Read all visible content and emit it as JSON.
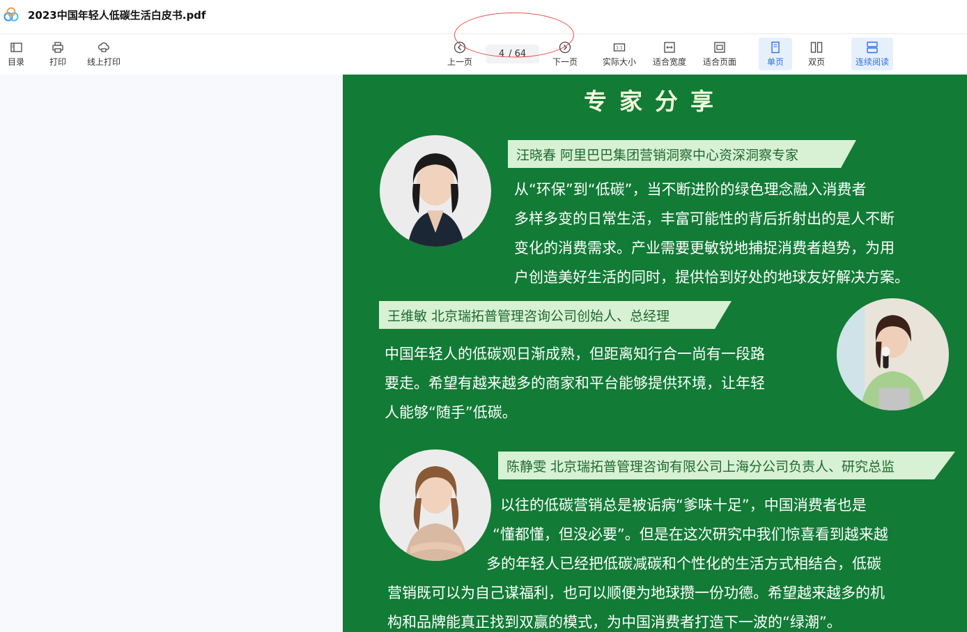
{
  "window": {
    "title": "2023中国年轻人低碳生活白皮书.pdf"
  },
  "toolbar": {
    "toc_label": "目录",
    "print_label": "打印",
    "online_print_label": "线上打印",
    "prev_label": "上一页",
    "next_label": "下一页",
    "page_current": "4",
    "page_total": "/ 64",
    "actual_size_label": "实际大小",
    "fit_width_label": "适合宽度",
    "fit_page_label": "适合页面",
    "single_page_label": "单页",
    "double_page_label": "双页",
    "continuous_label": "连续阅读",
    "accent_color": "#2f6fe0"
  },
  "page": {
    "background_color": "#127b36",
    "heading": "专家分享",
    "experts": [
      {
        "name_title": "汪晓春  阿里巴巴集团营销洞察中心资深洞察专家",
        "quote_lines": [
          "从“环保”到“低碳”，当不断进阶的绿色理念融入消费者",
          "多样多变的日常生活，丰富可能性的背后折射出的是人不断",
          "变化的消费需求。产业需要更敏锐地捕捉消费者趋势，为用",
          "户创造美好生活的同时，提供恰到好处的地球友好解决方案。"
        ]
      },
      {
        "name_title": "王维敏  北京瑞拓普管理咨询公司创始人、总经理",
        "quote_lines": [
          "中国年轻人的低碳观日渐成熟，但距离知行合一尚有一段路",
          "要走。希望有越来越多的商家和平台能够提供环境，让年轻",
          "人能够“随手”低碳。"
        ]
      },
      {
        "name_title": "陈静雯 北京瑞拓普管理咨询有限公司上海分公司负责人、研究总监",
        "quote_lines": [
          "以往的低碳营销总是被诟病“爹味十足”，中国消费者也是",
          "“懂都懂，但没必要”。但是在这次研究中我们惊喜看到越来越",
          "多的年轻人已经把低碳减碳和个性化的生活方式相结合，低碳",
          "营销既可以为自己谋福利，也可以顺便为地球攒一份功德。希望越来越多的机",
          "构和品牌能真正找到双赢的模式，为中国消费者打造下一波的“绿潮”。"
        ]
      }
    ]
  }
}
